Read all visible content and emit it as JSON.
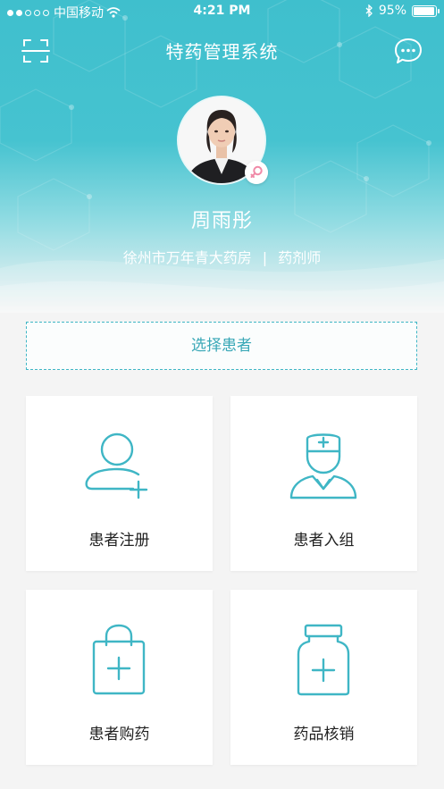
{
  "status_bar": {
    "carrier": "中国移动",
    "time": "4:21 PM",
    "battery": "95%"
  },
  "header": {
    "title": "特药管理系统",
    "left_icon": "scan-icon",
    "right_icon": "chat-bubble-icon"
  },
  "profile": {
    "name": "周雨彤",
    "pharmacy": "徐州市万年青大药房",
    "separator": "|",
    "role": "药剂师",
    "gender_icon": "female-icon"
  },
  "select_patient_label": "选择患者",
  "menu": [
    {
      "label": "患者注册",
      "icon": "add-user-icon"
    },
    {
      "label": "患者入组",
      "icon": "doctor-icon"
    },
    {
      "label": "患者购药",
      "icon": "shopping-bag-icon"
    },
    {
      "label": "药品核销",
      "icon": "medicine-bottle-icon"
    }
  ],
  "colors": {
    "accent": "#3fb6c5",
    "header_bg": "#42c1ce",
    "badge_pink": "#f08aa8"
  }
}
